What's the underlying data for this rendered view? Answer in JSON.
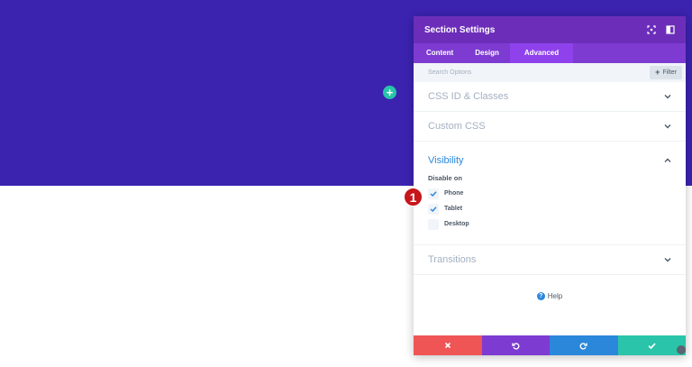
{
  "panel": {
    "title": "Section Settings",
    "tabs": [
      {
        "label": "Content"
      },
      {
        "label": "Design"
      },
      {
        "label": "Advanced"
      }
    ],
    "search_placeholder": "Search Options",
    "filter_label": "Filter",
    "groups": [
      {
        "title": "CSS ID & Classes"
      },
      {
        "title": "Custom CSS"
      },
      {
        "title": "Visibility"
      },
      {
        "title": "Transitions"
      }
    ],
    "visibility": {
      "label": "Disable on",
      "options": [
        {
          "label": "Phone",
          "checked": true
        },
        {
          "label": "Tablet",
          "checked": true
        },
        {
          "label": "Desktop",
          "checked": false
        }
      ]
    },
    "help_label": "Help"
  },
  "marker_number": "1",
  "colors": {
    "hero": "#3b23b0",
    "header": "#6c2eb9",
    "tabs": "#7d3bd1",
    "tab_active": "#8f42ec",
    "cancel": "#ef5555",
    "undo": "#7d3bd1",
    "redo": "#2b87da",
    "save": "#29c4a9",
    "accent_blue": "#2b87da",
    "marker": "#c7151b"
  }
}
